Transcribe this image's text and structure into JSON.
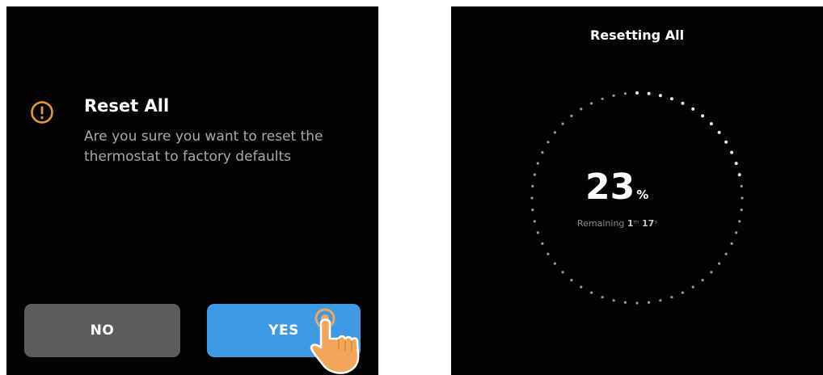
{
  "reset_dialog": {
    "title": "Reset All",
    "message": "Are you sure you want to reset the thermostat to factory defaults",
    "no_label": "NO",
    "yes_label": "YES",
    "icon": "exclamation-circle-icon",
    "accent_color": "#e09a3a",
    "yes_color": "#3e9ae3",
    "no_color": "#5c5c5c"
  },
  "progress_screen": {
    "title": "Resetting All",
    "percent": "23",
    "percent_unit": "%",
    "remaining_label": "Remaining",
    "remaining_minutes": "1",
    "remaining_seconds": "17",
    "progress_fraction": 0.23
  }
}
